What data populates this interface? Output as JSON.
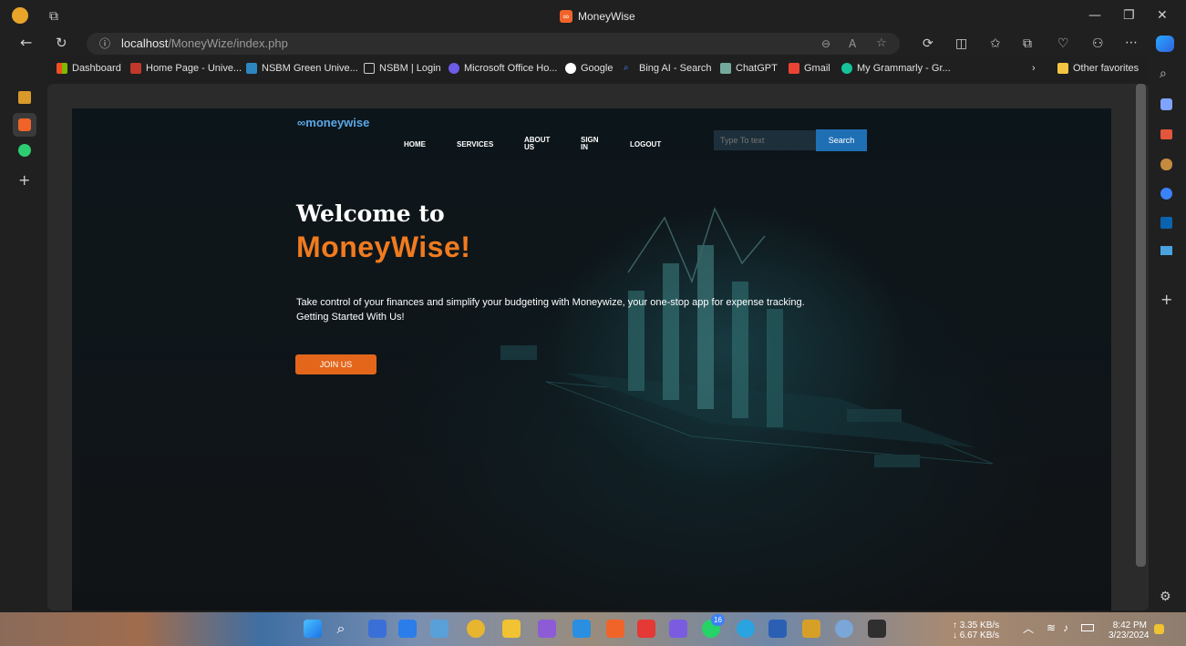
{
  "window": {
    "title": "MoneyWise",
    "minimize": "—",
    "restore": "❐",
    "close": "✕"
  },
  "address_bar": {
    "host": "localhost",
    "path": "/MoneyWize/index.php"
  },
  "bookmarks": [
    "Dashboard",
    "Home Page - Unive...",
    "NSBM Green Unive...",
    "NSBM | Login",
    "Microsoft Office Ho...",
    "Google",
    "Bing AI - Search",
    "ChatGPT",
    "Gmail",
    "My Grammarly - Gr...",
    "Other favorites"
  ],
  "site": {
    "logo": "moneywise",
    "nav": {
      "home": "HOME",
      "services": "SERVICES",
      "about": "ABOUT US",
      "signin": "SIGN IN",
      "logout": "LOGOUT"
    },
    "search_placeholder": "Type To text",
    "search_button": "Search",
    "welcome": "Welcome to",
    "brand": "MoneyWise!",
    "tagline_1": "Take control of your finances and simplify your budgeting with Moneywize, your one-stop app for expense tracking.",
    "tagline_2": "Getting Started With Us!",
    "join_button": "JOIN US"
  },
  "taskbar": {
    "upload": "↑ 3.35 KB/s",
    "download": "↓ 6.67 KB/s",
    "time": "8:42 PM",
    "date": "3/23/2024",
    "badge": "16"
  }
}
